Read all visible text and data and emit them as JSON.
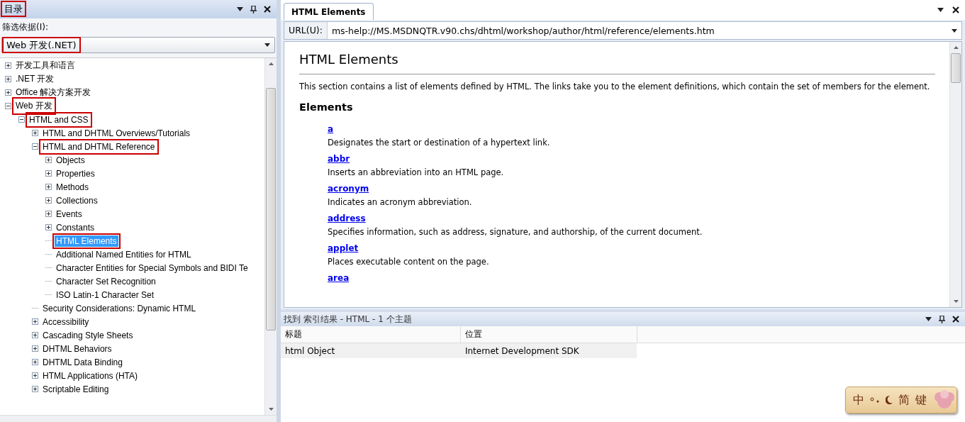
{
  "toc_panel": {
    "title": "目录",
    "title_marked": true,
    "filter_label": "筛选依据(I):",
    "filter_value": "Web 开发(.NET)",
    "filter_marked": true,
    "tree": [
      {
        "label": "开发工具和语言",
        "kind": "node",
        "expanded": false,
        "selected": false,
        "marked": false
      },
      {
        "label": ".NET 开发",
        "kind": "node",
        "expanded": false,
        "selected": false,
        "marked": false
      },
      {
        "label": "Office 解决方案开发",
        "kind": "node",
        "expanded": false,
        "selected": false,
        "marked": false
      },
      {
        "label": "Web 开发",
        "kind": "node",
        "expanded": true,
        "selected": false,
        "marked": true,
        "children": [
          {
            "label": "HTML and CSS",
            "kind": "node",
            "expanded": true,
            "selected": false,
            "marked": true,
            "children": [
              {
                "label": "HTML and DHTML Overviews/Tutorials",
                "kind": "node",
                "expanded": false,
                "selected": false,
                "marked": false
              },
              {
                "label": "HTML and DHTML Reference",
                "kind": "node",
                "expanded": true,
                "selected": false,
                "marked": true,
                "children": [
                  {
                    "label": "Objects",
                    "kind": "node",
                    "expanded": false,
                    "selected": false,
                    "marked": false
                  },
                  {
                    "label": "Properties",
                    "kind": "node",
                    "expanded": false,
                    "selected": false,
                    "marked": false
                  },
                  {
                    "label": "Methods",
                    "kind": "node",
                    "expanded": false,
                    "selected": false,
                    "marked": false
                  },
                  {
                    "label": "Collections",
                    "kind": "node",
                    "expanded": false,
                    "selected": false,
                    "marked": false
                  },
                  {
                    "label": "Events",
                    "kind": "node",
                    "expanded": false,
                    "selected": false,
                    "marked": false
                  },
                  {
                    "label": "Constants",
                    "kind": "node",
                    "expanded": false,
                    "selected": false,
                    "marked": false
                  },
                  {
                    "label": "HTML Elements",
                    "kind": "leaf",
                    "selected": true,
                    "marked": true
                  },
                  {
                    "label": "Additional Named Entities for HTML",
                    "kind": "leaf",
                    "selected": false,
                    "marked": false
                  },
                  {
                    "label": "Character Entities for Special Symbols and BIDI Te",
                    "kind": "leaf",
                    "selected": false,
                    "marked": false
                  },
                  {
                    "label": "Character Set Recognition",
                    "kind": "leaf",
                    "selected": false,
                    "marked": false
                  },
                  {
                    "label": "ISO Latin-1 Character Set",
                    "kind": "leaf",
                    "selected": false,
                    "marked": false
                  }
                ]
              },
              {
                "label": "Security Considerations: Dynamic HTML",
                "kind": "leaf",
                "selected": false,
                "marked": false
              },
              {
                "label": "Accessibility",
                "kind": "node",
                "expanded": false,
                "selected": false,
                "marked": false
              },
              {
                "label": "Cascading Style Sheets",
                "kind": "node",
                "expanded": false,
                "selected": false,
                "marked": false
              },
              {
                "label": "DHTML Behaviors",
                "kind": "node",
                "expanded": false,
                "selected": false,
                "marked": false
              },
              {
                "label": "DHTML Data Binding",
                "kind": "node",
                "expanded": false,
                "selected": false,
                "marked": false
              },
              {
                "label": "HTML Applications (HTA)",
                "kind": "node",
                "expanded": false,
                "selected": false,
                "marked": false
              },
              {
                "label": "Scriptable Editing",
                "kind": "node",
                "expanded": false,
                "selected": false,
                "marked": false
              }
            ]
          }
        ]
      }
    ]
  },
  "document": {
    "tab": "HTML Elements",
    "url_label": "URL(U):",
    "url": "ms-help://MS.MSDNQTR.v90.chs/dhtml/workshop/author/html/reference/elements.htm",
    "heading": "HTML Elements",
    "intro": "This section contains a list of elements defined by HTML. The links take you to the element definitions, which contain the set of members for the element.",
    "section": "Elements",
    "elements": [
      {
        "name": "a",
        "description": "Designates the start or destination of a hypertext link."
      },
      {
        "name": "abbr",
        "description": "Inserts an abbreviation into an HTML page."
      },
      {
        "name": "acronym",
        "description": "Indicates an acronym abbreviation."
      },
      {
        "name": "address",
        "description": "Specifies information, such as address, signature, and authorship, of the current document."
      },
      {
        "name": "applet",
        "description": "Places executable content on the page."
      },
      {
        "name": "area"
      }
    ]
  },
  "results": {
    "title": "找到 索引结果 - HTML - 1 个主题",
    "columns": [
      "标题",
      "位置"
    ],
    "rows": [
      [
        "html Object",
        "Internet Development SDK"
      ]
    ]
  },
  "ime_bar": {
    "mode": "中",
    "punct": "简",
    "keys": "键"
  }
}
